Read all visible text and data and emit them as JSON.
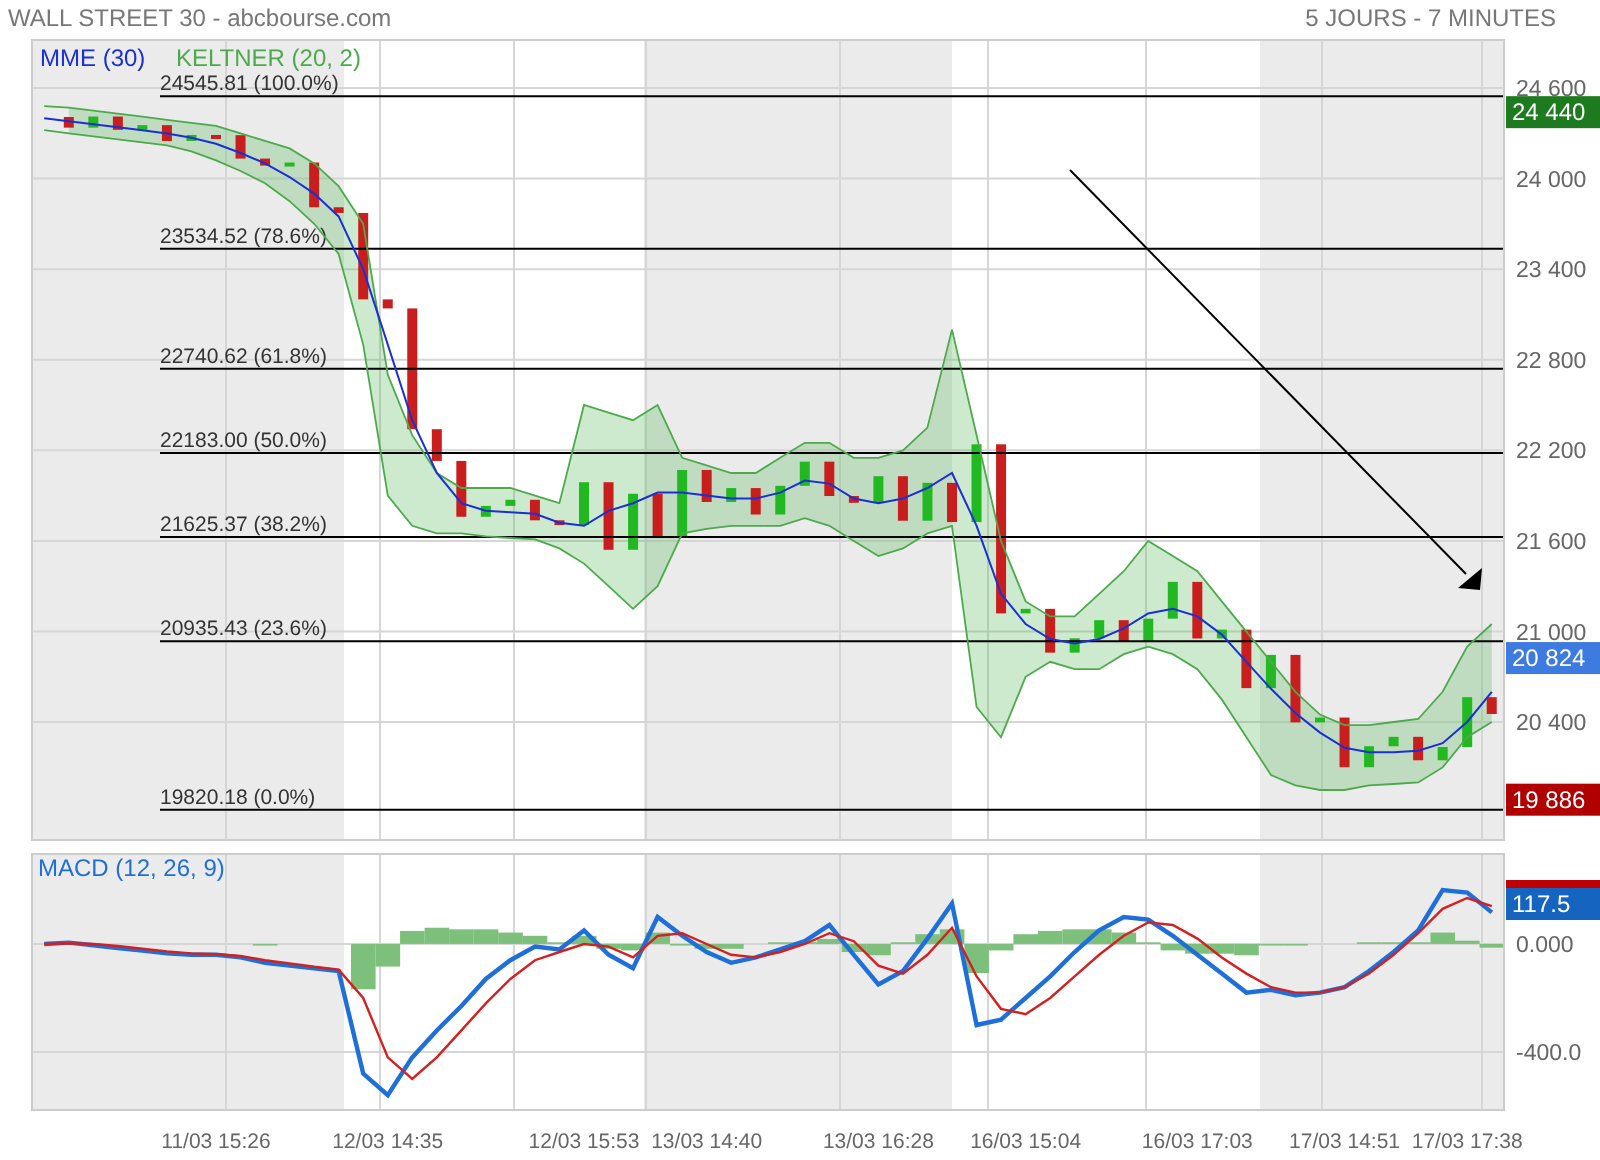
{
  "header": {
    "title": "WALL STREET 30 - abcbourse.com",
    "period": "5 JOURS - 7 MINUTES"
  },
  "price_panel": {
    "fib_levels": [
      {
        "price": "24545.81",
        "percent": "(100.0%)"
      },
      {
        "price": "23534.52",
        "percent": "(78.6%)"
      },
      {
        "price": "22740.62",
        "percent": "(61.8%)"
      },
      {
        "price": "22183.00",
        "percent": "(50.0%)"
      },
      {
        "price": "21625.37",
        "percent": "(38.2%)"
      },
      {
        "price": "20935.43",
        "percent": "(23.6%)"
      },
      {
        "price": "19820.18",
        "percent": "(0.0%)"
      }
    ],
    "price_tags": [
      {
        "text": "24 440",
        "color": "#1e7a1e"
      },
      {
        "text": "20 824",
        "color": "#3d7be0"
      },
      {
        "text": "19 886",
        "color": "#b00000"
      }
    ],
    "chart_data": {
      "type": "line",
      "grid": true,
      "ylim": [
        19619,
        24918
      ],
      "categories": [
        null,
        null,
        null,
        null,
        null,
        null,
        null,
        null,
        null,
        null,
        null,
        null,
        null,
        null,
        null,
        null,
        null,
        null,
        null,
        null,
        null,
        null,
        null,
        null,
        null,
        null,
        null,
        null,
        null,
        null,
        null,
        null,
        null,
        null,
        null,
        null,
        null,
        null,
        null,
        null,
        null,
        null,
        null,
        null,
        null,
        null,
        null,
        null,
        null,
        null,
        null,
        null,
        null,
        null,
        null,
        null,
        null,
        null,
        null,
        null
      ],
      "yticks": [
        {
          "value": 24600,
          "label": "24 600"
        },
        {
          "value": 24000,
          "label": "24 000"
        },
        {
          "value": 23400,
          "label": "23 400"
        },
        {
          "value": 22800,
          "label": "22 800"
        },
        {
          "value": 22200,
          "label": "22 200"
        },
        {
          "value": 21600,
          "label": "21 600"
        },
        {
          "value": 21000,
          "label": "21 000"
        },
        {
          "value": 20400,
          "label": "20 400"
        }
      ],
      "series": [
        {
          "name": "MME (30)",
          "color": "#1a2fd6",
          "values": [
            24400,
            24380,
            24360,
            24340,
            24320,
            24300,
            24270,
            24230,
            24170,
            24100,
            24010,
            23900,
            23750,
            23400,
            22900,
            22400,
            22050,
            21850,
            21800,
            21790,
            21780,
            21720,
            21700,
            21800,
            21850,
            21920,
            21920,
            21900,
            21880,
            21880,
            21920,
            22000,
            21980,
            21880,
            21850,
            21880,
            21950,
            22050,
            21700,
            21250,
            21050,
            20950,
            20920,
            20950,
            21020,
            21120,
            21150,
            21100,
            20980,
            20800,
            20620,
            20460,
            20330,
            20230,
            20200,
            20200,
            20210,
            20260,
            20400,
            20600
          ]
        },
        {
          "name": "KELTNER (20, 2)",
          "color": "#4caa4c",
          "values": [
            24480,
            24470,
            24450,
            24430,
            24410,
            24390,
            24370,
            24350,
            24300,
            24250,
            24200,
            24100,
            23950,
            23700,
            22700,
            22300,
            22050,
            21950,
            21950,
            21950,
            21900,
            21850,
            22500,
            22450,
            22400,
            22500,
            22150,
            22100,
            22050,
            22050,
            22150,
            22250,
            22250,
            22150,
            22150,
            22200,
            22350,
            23000,
            22300,
            21600,
            21200,
            21100,
            21100,
            21250,
            21400,
            21600,
            21500,
            21400,
            21200,
            21000,
            20800,
            20600,
            20450,
            20380,
            20380,
            20400,
            20420,
            20600,
            20900,
            21050
          ]
        },
        {
          "color": "#4caa4c",
          "values": [
            24320,
            24300,
            24280,
            24260,
            24240,
            24220,
            24180,
            24120,
            24050,
            23970,
            23850,
            23700,
            23500,
            22900,
            21900,
            21700,
            21650,
            21650,
            21630,
            21620,
            21610,
            21550,
            21450,
            21300,
            21150,
            21300,
            21650,
            21680,
            21700,
            21700,
            21700,
            21750,
            21700,
            21600,
            21500,
            21550,
            21650,
            21700,
            20500,
            20300,
            20700,
            20800,
            20750,
            20750,
            20850,
            20900,
            20850,
            20750,
            20550,
            20300,
            20050,
            19980,
            19950,
            19950,
            19980,
            19990,
            20000,
            20100,
            20300,
            20400
          ]
        }
      ]
    }
  },
  "macd_panel": {
    "value_tags": [
      {
        "color": "#c00000"
      },
      {
        "text": "117.5",
        "color": "#1565c0"
      }
    ],
    "chart_data": {
      "type": "line",
      "grid": true,
      "ylim": [
        -615,
        333
      ],
      "categories": [
        null,
        null,
        null,
        null,
        null,
        null,
        null,
        "11/03 15:26",
        null,
        null,
        null,
        null,
        null,
        null,
        "12/03 14:35",
        null,
        null,
        null,
        null,
        null,
        null,
        null,
        "12/03 15:53",
        null,
        null,
        null,
        null,
        "13/03 14:40",
        null,
        null,
        null,
        null,
        null,
        null,
        "13/03 16:28",
        null,
        null,
        null,
        null,
        null,
        "16/03 15:04",
        null,
        null,
        null,
        null,
        null,
        null,
        "16/03 17:03",
        null,
        null,
        null,
        null,
        null,
        "17/03 14:51",
        null,
        null,
        null,
        null,
        "17/03 17:38",
        null
      ],
      "yticks": [
        {
          "value": 0,
          "label": "0.000"
        },
        {
          "value": -400,
          "label": "-400.0"
        }
      ],
      "series": [
        {
          "name": "MACD (12, 26, 9)",
          "color": "#1e6fd9",
          "values": [
            0,
            5,
            -5,
            -15,
            -25,
            -35,
            -40,
            -40,
            -50,
            -70,
            -80,
            -90,
            -100,
            -480,
            -560,
            -420,
            -320,
            -230,
            -130,
            -60,
            -10,
            -20,
            50,
            -40,
            -90,
            100,
            30,
            -30,
            -70,
            -50,
            -20,
            10,
            70,
            -40,
            -150,
            -100,
            20,
            150,
            -300,
            -280,
            -200,
            -120,
            -30,
            50,
            100,
            90,
            30,
            -40,
            -110,
            -180,
            -170,
            -190,
            -180,
            -160,
            -100,
            -30,
            50,
            200,
            190,
            117
          ]
        },
        {
          "color": "#d42020",
          "values": [
            0,
            3,
            0,
            -8,
            -18,
            -28,
            -35,
            -38,
            -45,
            -60,
            -72,
            -85,
            -95,
            -200,
            -420,
            -500,
            -420,
            -320,
            -220,
            -130,
            -60,
            -30,
            0,
            -10,
            -50,
            30,
            40,
            0,
            -40,
            -50,
            -30,
            0,
            40,
            10,
            -80,
            -110,
            -40,
            60,
            -120,
            -240,
            -260,
            -200,
            -120,
            -40,
            30,
            80,
            70,
            20,
            -50,
            -110,
            -160,
            -180,
            -180,
            -160,
            -110,
            -40,
            40,
            130,
            170,
            140
          ]
        }
      ]
    }
  }
}
